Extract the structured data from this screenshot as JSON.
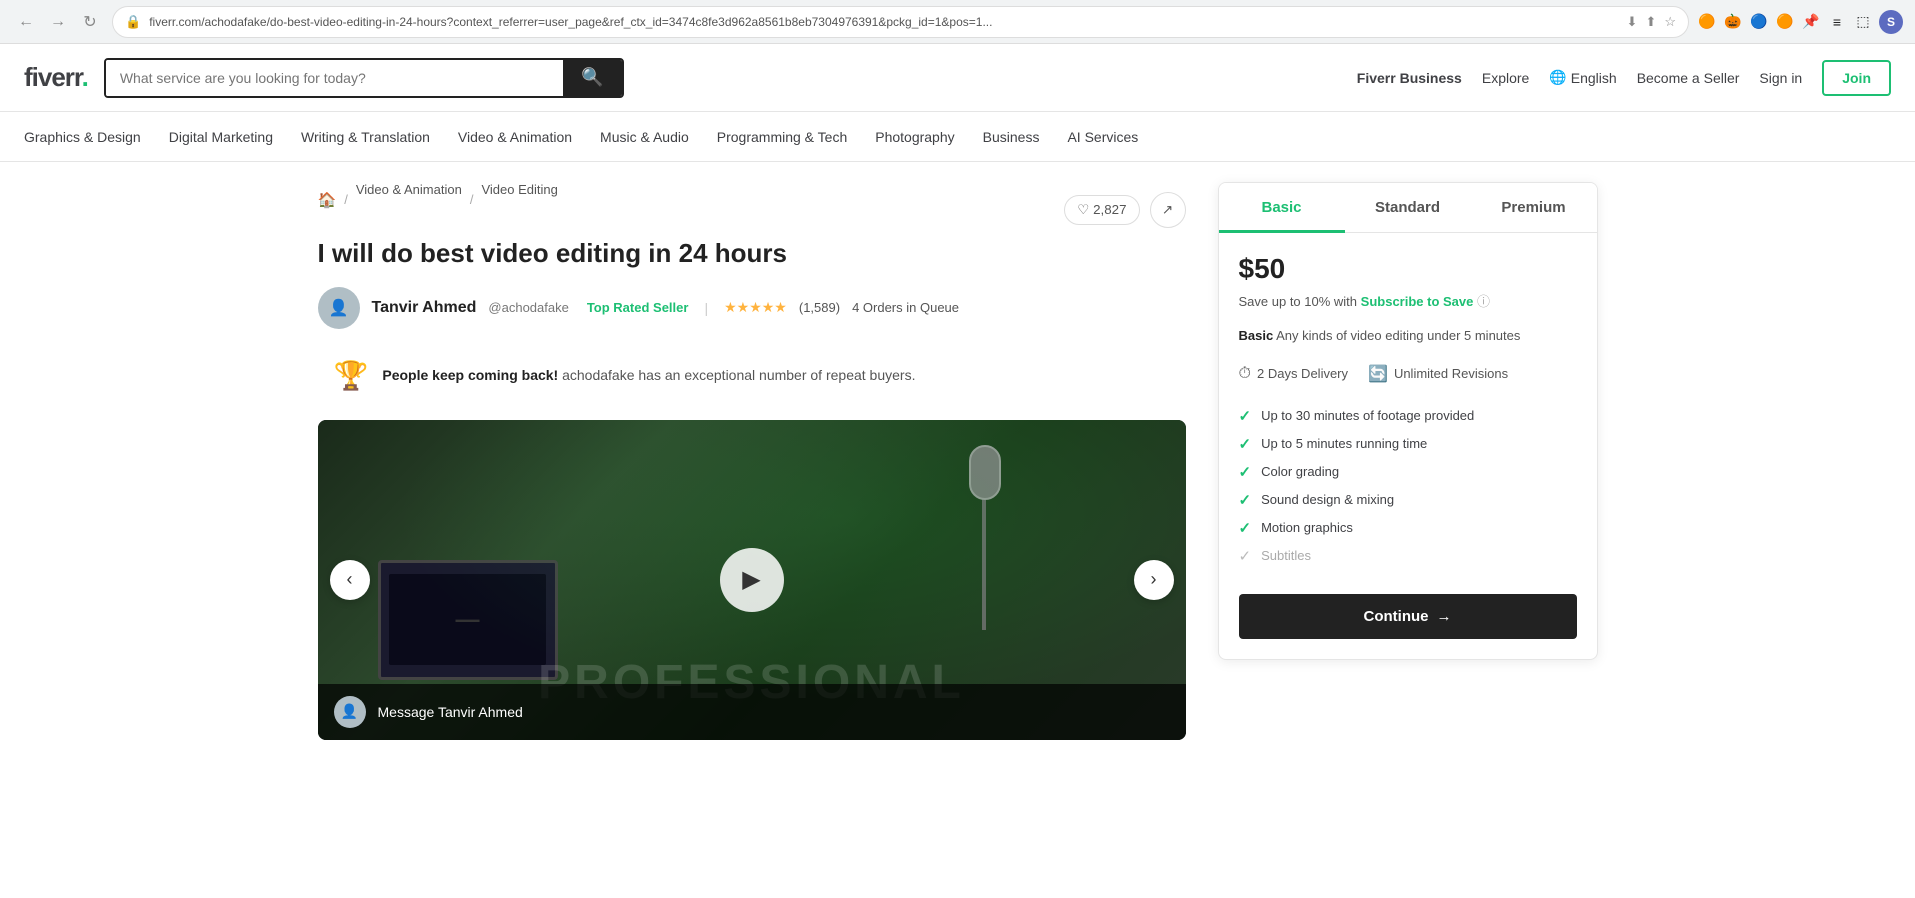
{
  "browser": {
    "url": "fiverr.com/achodafake/do-best-video-editing-in-24-hours?context_referrer=user_page&ref_ctx_id=3474c8fe3d962a8561b8eb7304976391&pckg_id=1&pos=1...",
    "back_label": "←",
    "forward_label": "→",
    "reload_label": "↻",
    "avatar_initial": "S"
  },
  "header": {
    "logo_text": "fiverr",
    "logo_dot": ".",
    "search_placeholder": "What service are you looking for today?",
    "nav_items": [
      {
        "label": "Fiverr Business",
        "bold": true
      },
      {
        "label": "Explore"
      },
      {
        "label": "English",
        "globe": true
      },
      {
        "label": "Become a Seller"
      },
      {
        "label": "Sign in"
      },
      {
        "label": "Join",
        "btn": true
      }
    ]
  },
  "categories": [
    "Graphics & Design",
    "Digital Marketing",
    "Writing & Translation",
    "Video & Animation",
    "Music & Audio",
    "Programming & Tech",
    "Photography",
    "Business",
    "AI Services"
  ],
  "breadcrumb": {
    "home_icon": "🏠",
    "items": [
      {
        "label": "Video & Animation",
        "href": "#"
      },
      {
        "label": "Video Editing",
        "href": "#"
      }
    ],
    "like_count": "2,827"
  },
  "gig": {
    "title": "I will do best video editing in 24 hours",
    "seller": {
      "name": "Tanvir Ahmed",
      "handle": "@achodafake",
      "badge": "Top Rated Seller",
      "rating": "5",
      "stars": "★★★★★",
      "review_count": "(1,589)",
      "orders_queue": "4 Orders in Queue"
    },
    "repeat_buyers_notice": {
      "icon": "🏆",
      "bold_text": "People keep coming back!",
      "text": " achodafake has an exceptional number of repeat buyers."
    },
    "image_overlay": "PROFESSIONAL",
    "message_bar": {
      "text": "Message Tanvir Ahmed"
    }
  },
  "pricing": {
    "tabs": [
      {
        "label": "Basic",
        "active": true
      },
      {
        "label": "Standard",
        "active": false
      },
      {
        "label": "Premium",
        "active": false
      }
    ],
    "active_tab": {
      "price": "$50",
      "save_text": "Save up to 10% with",
      "save_link": "Subscribe to Save",
      "package_label": "Basic",
      "package_desc": "Any kinds of video editing under 5 minutes",
      "delivery": {
        "days": "2 Days Delivery",
        "revisions": "Unlimited Revisions"
      },
      "features": [
        {
          "label": "Up to 30 minutes of footage provided",
          "included": true
        },
        {
          "label": "Up to 5 minutes running time",
          "included": true
        },
        {
          "label": "Color grading",
          "included": true
        },
        {
          "label": "Sound design & mixing",
          "included": true
        },
        {
          "label": "Motion graphics",
          "included": true
        },
        {
          "label": "Subtitles",
          "included": false
        }
      ],
      "continue_btn": "Continue",
      "continue_arrow": "→"
    }
  }
}
